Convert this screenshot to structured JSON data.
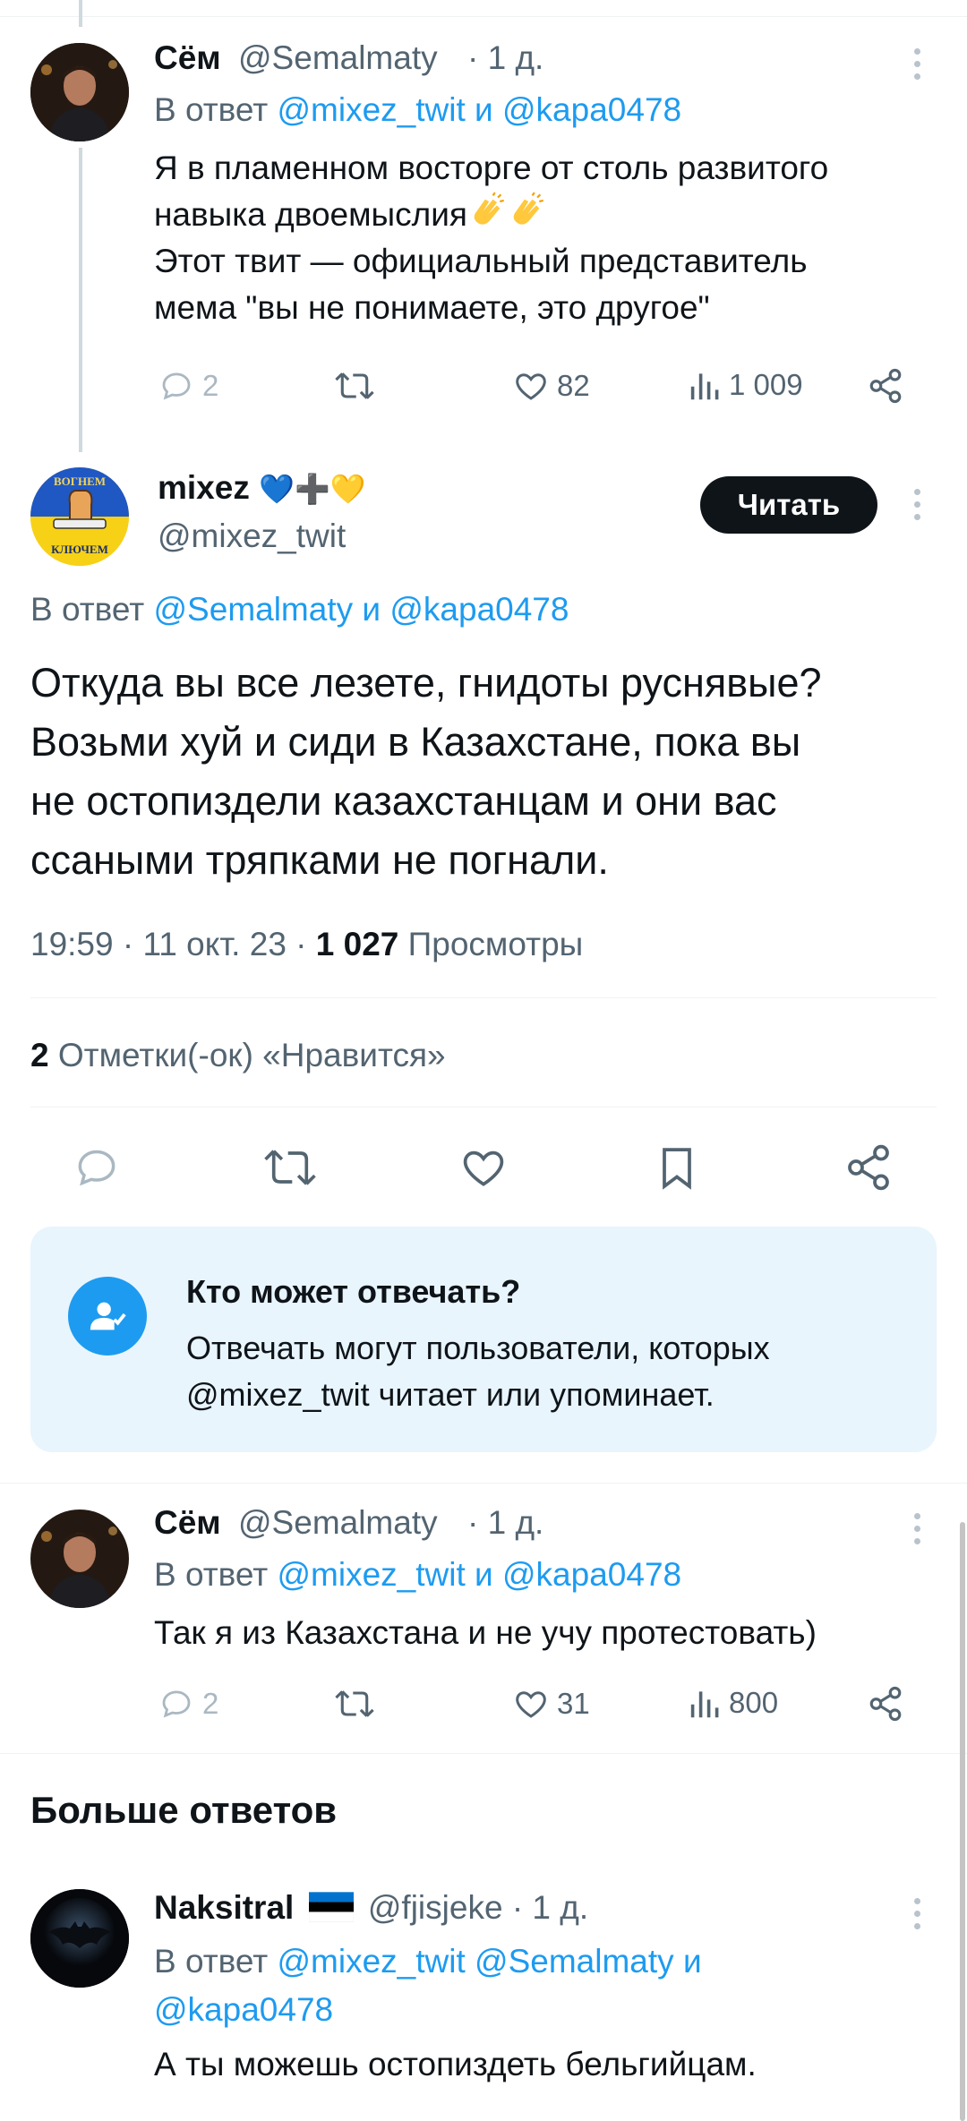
{
  "reply1": {
    "name": "Сём",
    "handle": "@Semalmaty",
    "time": "· 1 д.",
    "reply_prefix": "В ответ",
    "reply_to_1": "@mixez_twit",
    "reply_and": "и",
    "reply_to_2": "@kapa0478",
    "text_line1": "Я в пламенном восторге от столь развитого",
    "text_line2": "навыка двоемыслия",
    "text_line3": "Этот твит — официальный представитель",
    "text_line4": "мема \"вы не понимаете, это другое\"",
    "replies": "2",
    "likes": "82",
    "views": "1 009"
  },
  "main": {
    "name": "mixez",
    "name_emoji": "💙➕💛",
    "handle": "@mixez_twit",
    "follow_label": "Читать",
    "avatar_top": "ВОГНЕМ",
    "avatar_bottom": "КЛЮЧЕМ",
    "reply_prefix": "В ответ",
    "reply_to_1": "@Semalmaty",
    "reply_and": "и",
    "reply_to_2": "@kapa0478",
    "text_line1": "Откуда вы все лезете, гнидоты руснявые?",
    "text_line2": "Возьми хуй и сиди в Казахстане, пока вы",
    "text_line3": "не остопиздели казахстанцам и они вас",
    "text_line4": "ссаными тряпками не погнали.",
    "timestamp": "19:59 · 11 окт. 23 ·",
    "views_count": "1 027",
    "views_label": "Просмотры",
    "likes_count": "2",
    "likes_label": "Отметки(-ок) «Нравится»"
  },
  "reply_restriction": {
    "title": "Кто может отвечать?",
    "line1": "Отвечать могут пользователи, которых",
    "line2": "@mixez_twit читает или упоминает."
  },
  "reply2": {
    "name": "Сём",
    "handle": "@Semalmaty",
    "time": "· 1 д.",
    "reply_prefix": "В ответ",
    "reply_to_1": "@mixez_twit",
    "reply_and": "и",
    "reply_to_2": "@kapa0478",
    "text": "Так я из Казахстана и не учу протестовать)",
    "replies": "2",
    "likes": "31",
    "views": "800"
  },
  "more_replies": {
    "heading": "Больше ответов"
  },
  "reply3": {
    "name": "Naksitral",
    "handle": "@fjisjeke",
    "time": "· 1 д.",
    "reply_prefix": "В ответ",
    "reply_to_1": "@mixez_twit",
    "reply_to_2": "@Semalmaty",
    "reply_and": "и",
    "reply_to_3": "@kapa0478",
    "text": "А ты можешь остопиздеть бельгийцам."
  },
  "colors": {
    "accent": "#1d9bf0",
    "muted": "#536471",
    "follow_bg": "#0f1419",
    "restriction_bg": "#e8f5fd"
  }
}
